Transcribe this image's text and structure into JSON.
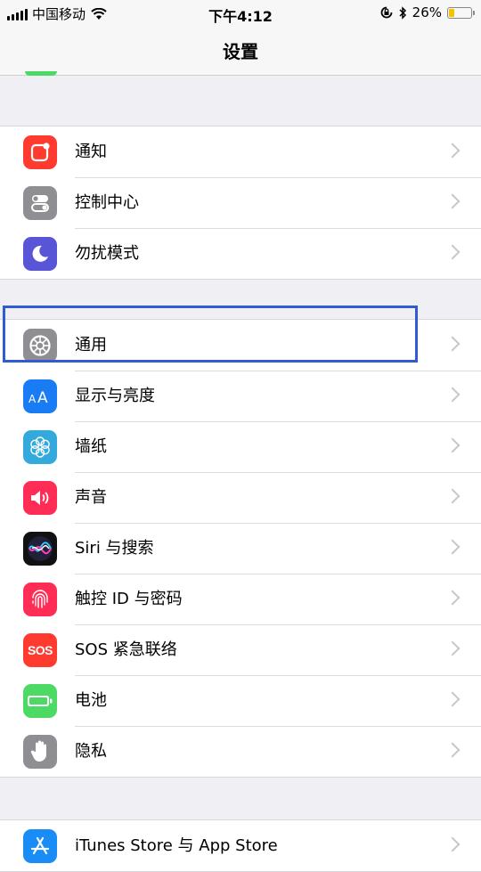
{
  "status_bar": {
    "carrier": "中国移动",
    "time": "下午4:12",
    "battery_percent": "26%",
    "battery_level": 0.26
  },
  "nav": {
    "title": "设置"
  },
  "groups": [
    {
      "items": [
        {
          "label": "通知",
          "icon": "notifications-icon",
          "color": "#ff3b30"
        },
        {
          "label": "控制中心",
          "icon": "control-center-icon",
          "color": "#8e8e93"
        },
        {
          "label": "勿扰模式",
          "icon": "moon-icon",
          "color": "#5856d6"
        }
      ]
    },
    {
      "items": [
        {
          "label": "通用",
          "icon": "gear-icon",
          "color": "#8e8e93",
          "highlighted": true
        },
        {
          "label": "显示与亮度",
          "icon": "display-brightness-icon",
          "color": "#1a7cf5"
        },
        {
          "label": "墙纸",
          "icon": "wallpaper-icon",
          "color": "#34aadc"
        },
        {
          "label": "声音",
          "icon": "sound-icon",
          "color": "#ff2d55"
        },
        {
          "label": "Siri 与搜索",
          "icon": "siri-icon",
          "color": "#1c1c2e"
        },
        {
          "label": "触控 ID 与密码",
          "icon": "fingerprint-icon",
          "color": "#ff2d55"
        },
        {
          "label": "SOS 紧急联络",
          "icon": "sos-icon",
          "color": "#ff3b30",
          "icon_text": "SOS"
        },
        {
          "label": "电池",
          "icon": "battery-icon",
          "color": "#4cd964"
        },
        {
          "label": "隐私",
          "icon": "hand-icon",
          "color": "#8e8e93"
        }
      ]
    },
    {
      "items": [
        {
          "label": "iTunes Store 与 App Store",
          "icon": "app-store-icon",
          "color": "#1a8cf5"
        }
      ]
    }
  ]
}
